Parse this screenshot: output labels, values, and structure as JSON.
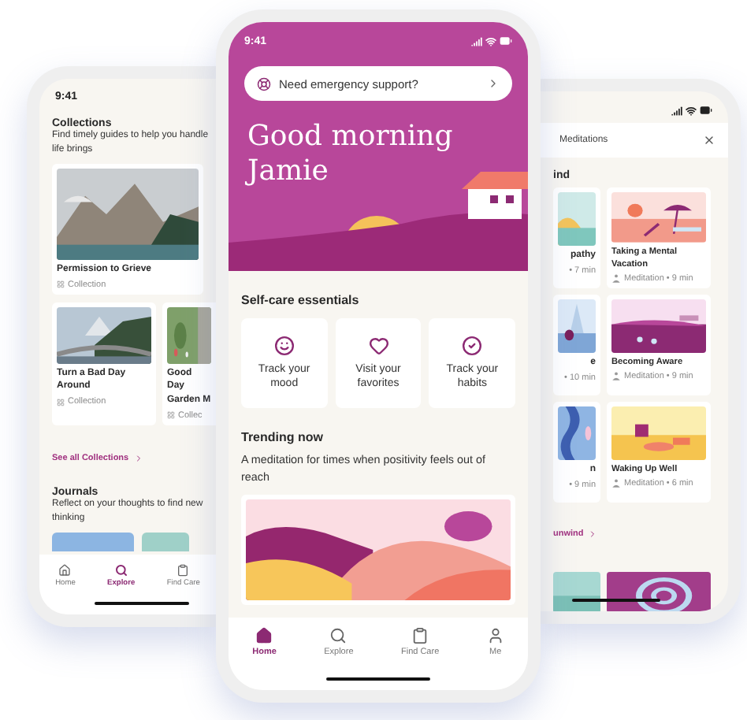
{
  "left_phone": {
    "time": "9:41",
    "collections": {
      "title": "Collections",
      "description_lines": [
        "Find timely guides to help you handle",
        "life brings"
      ],
      "cards": [
        {
          "kind": "wide",
          "title": "Permission to Grieve",
          "meta": "Collection"
        },
        {
          "kind": "half",
          "title": "Turn a Bad Day Around",
          "meta": "Collection"
        },
        {
          "kind": "partial",
          "title": "Good Day Garden M",
          "meta": "Collec"
        }
      ],
      "link": "See all Collections"
    },
    "journals": {
      "title": "Journals",
      "description_lines": [
        "Reflect on your thoughts to find new",
        "thinking"
      ]
    },
    "nav": [
      {
        "label": "Home",
        "selected": false
      },
      {
        "label": "Explore",
        "selected": true
      },
      {
        "label": "Find Care",
        "selected": false
      }
    ]
  },
  "center_phone": {
    "time": "9:41",
    "emergency": "Need emergency support?",
    "greeting": "Good morning Jamie",
    "self_care": {
      "title": "Self-care essentials",
      "items": [
        {
          "label": "Track your mood"
        },
        {
          "label": "Visit your favorites"
        },
        {
          "label": "Track your habits"
        }
      ]
    },
    "trending": {
      "title": "Trending now",
      "description": "A meditation for times when positivity feels out of reach"
    },
    "nav": [
      {
        "label": "Home",
        "selected": true
      },
      {
        "label": "Explore",
        "selected": false
      },
      {
        "label": "Find Care",
        "selected": false
      },
      {
        "label": "Me",
        "selected": false
      }
    ]
  },
  "right_phone": {
    "header": "Meditations",
    "section_title": "ind",
    "rows": [
      {
        "left": {
          "title": "pathy",
          "meta": "• 7 min"
        },
        "right": {
          "title": "Taking a Mental Vacation",
          "meta": "Meditation • 9 min"
        }
      },
      {
        "left": {
          "title": "e",
          "meta": "• 10 min"
        },
        "right": {
          "title": "Becoming Aware",
          "meta": "Meditation • 9 min"
        }
      },
      {
        "left": {
          "title": "n",
          "meta": "• 9 min"
        },
        "right": {
          "title": "Waking Up Well",
          "meta": "Meditation • 6 min"
        }
      }
    ],
    "link": "unwind"
  }
}
